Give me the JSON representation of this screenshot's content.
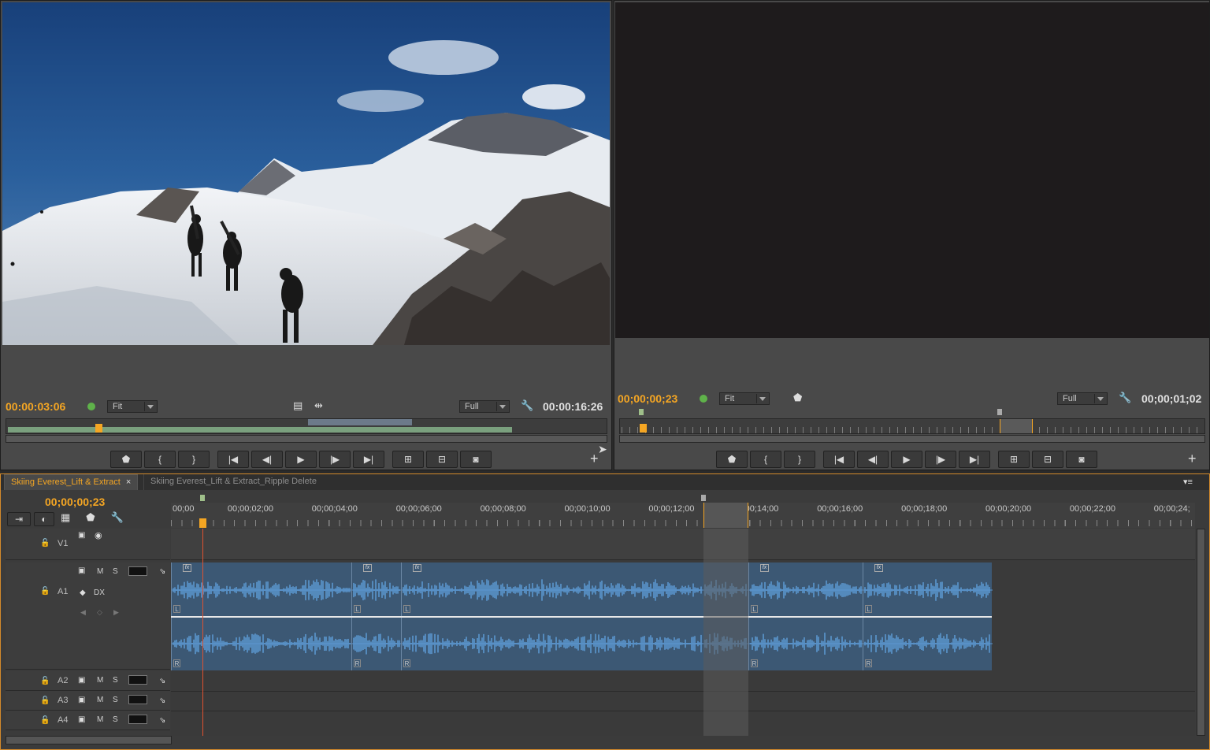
{
  "source_monitor": {
    "timecode_in": "00:00:03:06",
    "zoom": "Fit",
    "resolution": "Full",
    "timecode_duration": "00:00:16:26",
    "buttons": [
      "marker",
      "mark-in",
      "mark-out",
      "go-to-in",
      "step-back",
      "play",
      "step-forward",
      "go-to-out",
      "insert",
      "overwrite",
      "export-frame"
    ]
  },
  "program_monitor": {
    "timecode_in": "00;00;00;23",
    "zoom": "Fit",
    "resolution": "Full",
    "timecode_duration": "00;00;01;02",
    "buttons": [
      "marker",
      "mark-in",
      "mark-out",
      "go-to-in",
      "step-back",
      "play",
      "step-forward",
      "go-to-out",
      "lift",
      "extract",
      "export-frame"
    ]
  },
  "timeline": {
    "tabs": [
      {
        "label": "Skiing Everest_Lift & Extract",
        "active": true
      },
      {
        "label": "Skiing Everest_Lift & Extract_Ripple Delete",
        "active": false
      }
    ],
    "playhead_timecode": "00;00;00;23",
    "ruler_labels": [
      "00;00",
      "00;00;02;00",
      "00;00;04;00",
      "00;00;06;00",
      "00;00;08;00",
      "00;00;10;00",
      "00;00;12;00",
      "00;00;14;00",
      "00;00;16;00",
      "00;00;18;00",
      "00;00;20;00",
      "00;00;22;00",
      "00;00;24;"
    ],
    "tracks": {
      "v1": "V1",
      "a1": "A1",
      "a1_sub": "DX",
      "a2": "A2",
      "a3": "A3",
      "a4": "A4",
      "m": "M",
      "s": "S"
    },
    "channel_left": "L",
    "channel_right": "R",
    "fx_label": "fx"
  },
  "colors": {
    "accent_timecode": "#f5a623",
    "clip_audio": "#3c5874",
    "waveform": "#5b96cf",
    "playhead": "#e0522f"
  },
  "icons": [
    "film-icon",
    "wrench-icon",
    "marker-icon",
    "camera-icon",
    "plus-icon",
    "lock-icon",
    "eye-icon",
    "speaker-icon"
  ]
}
